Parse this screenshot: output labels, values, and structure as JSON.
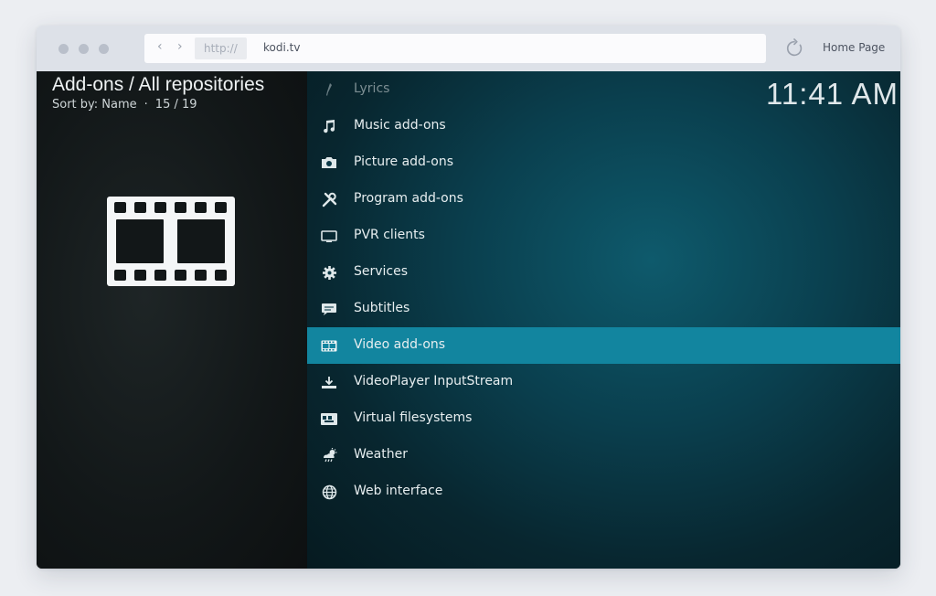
{
  "browser": {
    "protocol": "http://",
    "host": "kodi.tv",
    "home_label": "Home Page",
    "nav_arrows": "‹ ›"
  },
  "header": {
    "title": "Add-ons / All repositories",
    "sort_label": "Sort by: Name",
    "separator": "·",
    "position": "15 / 19",
    "clock": "11:41 AM"
  },
  "menu": {
    "items": [
      {
        "label": "Lyrics",
        "icon": "microphone-icon"
      },
      {
        "label": "Music add-ons",
        "icon": "music-note-icon"
      },
      {
        "label": "Picture add-ons",
        "icon": "camera-icon"
      },
      {
        "label": "Program add-ons",
        "icon": "tools-icon"
      },
      {
        "label": "PVR clients",
        "icon": "tv-icon"
      },
      {
        "label": "Services",
        "icon": "gear-icon"
      },
      {
        "label": "Subtitles",
        "icon": "speech-bubble-icon"
      },
      {
        "label": "Video add-ons",
        "icon": "film-strip-icon",
        "selected": true
      },
      {
        "label": "VideoPlayer InputStream",
        "icon": "input-stream-icon"
      },
      {
        "label": "Virtual filesystems",
        "icon": "archive-icon"
      },
      {
        "label": "Weather",
        "icon": "weather-icon"
      },
      {
        "label": "Web interface",
        "icon": "globe-icon"
      }
    ]
  },
  "colors": {
    "selection": "#12859f",
    "panel_dark": "#121718",
    "panel_teal": "#0a3f4e"
  }
}
